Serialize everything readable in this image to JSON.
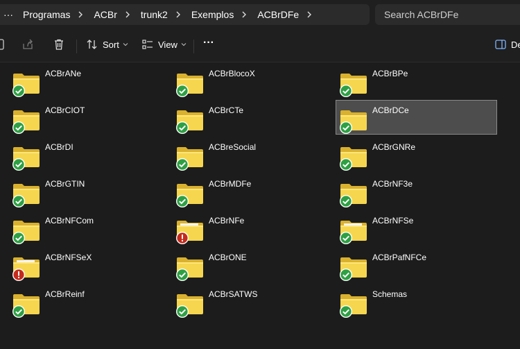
{
  "breadcrumb": {
    "more_label": "···",
    "items": [
      "Programas",
      "ACBr",
      "trunk2",
      "Exemplos",
      "ACBrDFe"
    ]
  },
  "search": {
    "placeholder": "Search ACBrDFe"
  },
  "toolbar": {
    "sort_label": "Sort",
    "view_label": "View",
    "more_label": "···",
    "details_label": "De"
  },
  "colors": {
    "background": "#1c1c1c",
    "folder": "#f5d64e",
    "sync_ok": "#2ea043",
    "sync_error": "#c42b1c",
    "selection": "#4d4d4d"
  },
  "folders": [
    {
      "name": "ACBrANe",
      "status": "synced",
      "icon": "folder-icon"
    },
    {
      "name": "ACBrBlocoX",
      "status": "synced",
      "icon": "folder-icon"
    },
    {
      "name": "ACBrBPe",
      "status": "synced",
      "icon": "folder-icon"
    },
    {
      "name": "ACBrCIOT",
      "status": "synced",
      "icon": "folder-icon"
    },
    {
      "name": "ACBrCTe",
      "status": "synced",
      "icon": "folder-icon"
    },
    {
      "name": "ACBrDCe",
      "status": "synced",
      "icon": "folder-icon",
      "selected": true
    },
    {
      "name": "ACBrDI",
      "status": "synced",
      "icon": "folder-icon"
    },
    {
      "name": "ACBreSocial",
      "status": "synced",
      "icon": "folder-icon"
    },
    {
      "name": "ACBrGNRe",
      "status": "synced",
      "icon": "folder-icon"
    },
    {
      "name": "ACBrGTIN",
      "status": "synced",
      "icon": "folder-icon"
    },
    {
      "name": "ACBrMDFe",
      "status": "synced",
      "icon": "folder-icon"
    },
    {
      "name": "ACBrNF3e",
      "status": "synced",
      "icon": "folder-icon"
    },
    {
      "name": "ACBrNFCom",
      "status": "synced",
      "icon": "folder-icon"
    },
    {
      "name": "ACBrNFe",
      "status": "error",
      "icon": "folder-with-document-icon"
    },
    {
      "name": "ACBrNFSe",
      "status": "synced",
      "icon": "folder-with-document-icon"
    },
    {
      "name": "ACBrNFSeX",
      "status": "error",
      "icon": "folder-with-document-icon"
    },
    {
      "name": "ACBrONE",
      "status": "synced",
      "icon": "folder-icon"
    },
    {
      "name": "ACBrPafNFCe",
      "status": "synced",
      "icon": "folder-icon"
    },
    {
      "name": "ACBrReinf",
      "status": "synced",
      "icon": "folder-icon"
    },
    {
      "name": "ACBrSATWS",
      "status": "synced",
      "icon": "folder-icon"
    },
    {
      "name": "Schemas",
      "status": "synced",
      "icon": "folder-icon"
    }
  ]
}
